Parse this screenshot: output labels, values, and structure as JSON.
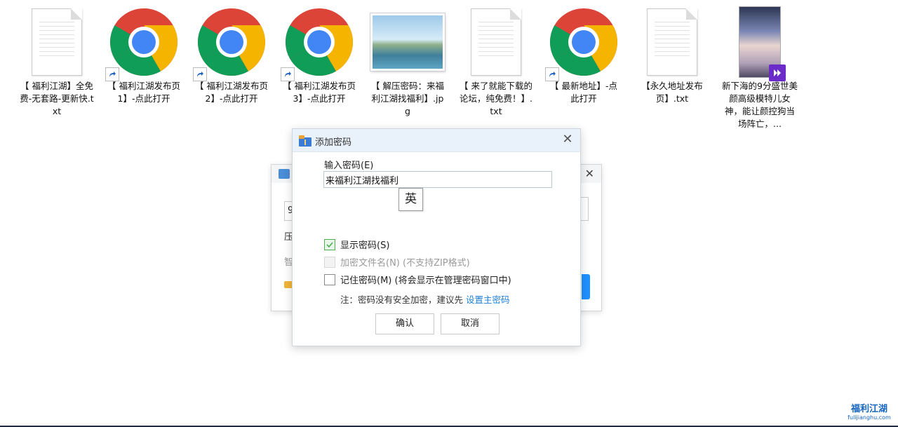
{
  "desktop": {
    "files": [
      {
        "label": "【 福利江湖】全免费-无套路-更新快.txt",
        "icon": "text-file-icon"
      },
      {
        "label": "【 福利江湖发布页1】-点此打开",
        "icon": "chrome-icon"
      },
      {
        "label": "【 福利江湖发布页2】-点此打开",
        "icon": "chrome-icon"
      },
      {
        "label": "【 福利江湖发布页3】-点此打开",
        "icon": "chrome-icon"
      },
      {
        "label": "【 解压密码：来福利江湖找福利】.jpg",
        "icon": "image-file-icon"
      },
      {
        "label": "【 来了就能下载的论坛，纯免费！】.txt",
        "icon": "text-file-icon"
      },
      {
        "label": "【 最新地址】-点此打开",
        "icon": "chrome-icon"
      },
      {
        "label": "【永久地址发布页】.txt",
        "icon": "text-file-icon"
      },
      {
        "label": "新下海的9分盛世美颜高级模特儿女神，能让颜控狗当场阵亡，...",
        "icon": "video-file-icon"
      }
    ]
  },
  "background_dialog": {
    "field_prefix": "9",
    "row1": "压",
    "row2": "智"
  },
  "dialog": {
    "title": "添加密码",
    "password_label": "输入密码(E)",
    "password_value": "来福利江湖找福利",
    "ime_indicator": "英",
    "show_password": {
      "label": "显示密码(S)",
      "checked": true
    },
    "encrypt_filenames": {
      "label": "加密文件名(N) (不支持ZIP格式)",
      "disabled": true
    },
    "remember_password": {
      "label": "记住密码(M) (将会显示在管理密码窗口中)",
      "checked": false
    },
    "note_prefix": "注：密码没有安全加密，建议先",
    "note_link": "设置主密码",
    "ok_label": "确认",
    "cancel_label": "取消"
  },
  "watermark": {
    "line1": "福利江湖",
    "line2": "fulijianghu.com"
  },
  "colors": {
    "accent": "#1e7fd6",
    "check": "#4caf50",
    "titlebar": "#e9f1fa"
  }
}
